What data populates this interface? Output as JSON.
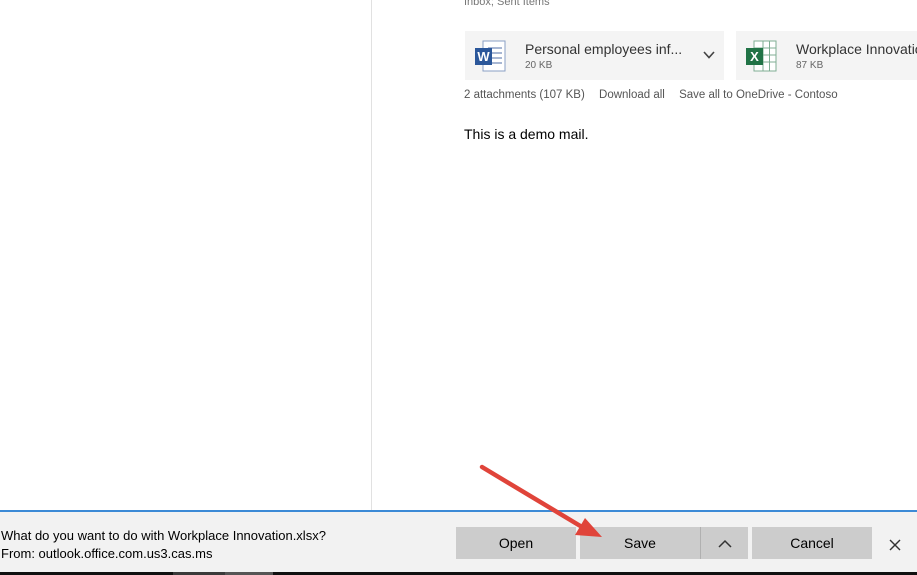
{
  "mail": {
    "folders": "Inbox; Sent Items",
    "body": "This is a demo mail."
  },
  "attachments": [
    {
      "name": "Personal employees inf...",
      "size": "20 KB",
      "icon": "word-icon",
      "color": "#2b579a"
    },
    {
      "name": "Workplace Innovatio",
      "size": "87 KB",
      "icon": "excel-icon",
      "color": "#217346"
    }
  ],
  "attachment_bar": {
    "summary": "2 attachments (107 KB)",
    "download_all": "Download all",
    "save_all": "Save all to OneDrive - Contoso"
  },
  "download_bar": {
    "question": "What do you want to do with Workplace Innovation.xlsx?",
    "from": "From: outlook.office.com.us3.cas.ms",
    "open_label": "Open",
    "save_label": "Save",
    "cancel_label": "Cancel",
    "accent": "#3c8ad6"
  },
  "annotation": {
    "arrow_color": "#e0443a"
  }
}
